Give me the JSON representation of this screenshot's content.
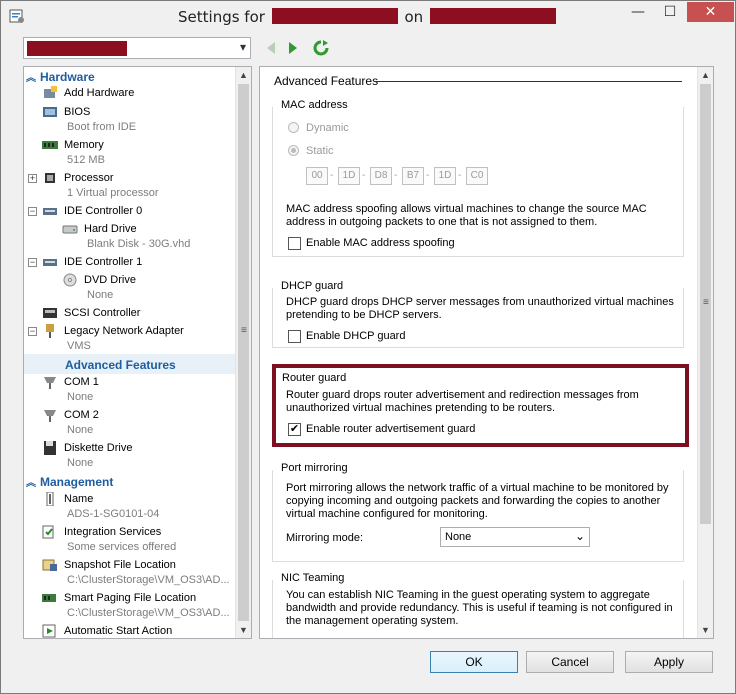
{
  "window": {
    "title_prefix": "Settings for",
    "title_middle": "on",
    "buttons": {
      "minimize": "—",
      "maximize": "☐",
      "close": "✕"
    }
  },
  "toolbar": {
    "vm_select_value": ""
  },
  "tree": {
    "hardware_header": "Hardware",
    "management_header": "Management",
    "hardware": [
      {
        "label": "Add Hardware",
        "sub": "",
        "icon": "add-hardware-icon"
      },
      {
        "label": "BIOS",
        "sub": "Boot from IDE",
        "icon": "bios-icon"
      },
      {
        "label": "Memory",
        "sub": "512 MB",
        "icon": "memory-icon"
      },
      {
        "label": "Processor",
        "sub": "1 Virtual processor",
        "icon": "processor-icon"
      },
      {
        "label": "IDE Controller 0",
        "sub": "",
        "icon": "ide-controller-icon"
      },
      {
        "label": "Hard Drive",
        "sub": "Blank Disk - 30G.vhd",
        "icon": "hard-drive-icon"
      },
      {
        "label": "IDE Controller 1",
        "sub": "",
        "icon": "ide-controller-icon"
      },
      {
        "label": "DVD Drive",
        "sub": "None",
        "icon": "dvd-drive-icon"
      },
      {
        "label": "SCSI Controller",
        "sub": "",
        "icon": "scsi-controller-icon"
      },
      {
        "label": "Legacy Network Adapter",
        "sub": "VMS",
        "icon": "network-adapter-icon"
      },
      {
        "label": "Advanced Features",
        "sub": "",
        "icon": ""
      },
      {
        "label": "COM 1",
        "sub": "None",
        "icon": "com-port-icon"
      },
      {
        "label": "COM 2",
        "sub": "None",
        "icon": "com-port-icon"
      },
      {
        "label": "Diskette Drive",
        "sub": "None",
        "icon": "diskette-icon"
      }
    ],
    "management": [
      {
        "label": "Name",
        "sub": "ADS-1-SG0101-04",
        "icon": "name-icon"
      },
      {
        "label": "Integration Services",
        "sub": "Some services offered",
        "icon": "integration-services-icon"
      },
      {
        "label": "Snapshot File Location",
        "sub": "C:\\ClusterStorage\\VM_OS3\\AD...",
        "icon": "snapshot-icon"
      },
      {
        "label": "Smart Paging File Location",
        "sub": "C:\\ClusterStorage\\VM_OS3\\AD...",
        "icon": "smart-paging-icon"
      },
      {
        "label": "Automatic Start Action",
        "sub": "",
        "icon": "auto-start-icon"
      }
    ]
  },
  "panel": {
    "title": "Advanced Features",
    "mac": {
      "group_title": "MAC address",
      "dynamic_label": "Dynamic",
      "static_label": "Static",
      "octets": [
        "00",
        "1D",
        "D8",
        "B7",
        "1D",
        "C0"
      ],
      "description": "MAC address spoofing allows virtual machines to change the source MAC address in outgoing packets to one that is not assigned to them.",
      "spoof_label": "Enable MAC address spoofing"
    },
    "dhcp": {
      "group_title": "DHCP guard",
      "description": "DHCP guard drops DHCP server messages from unauthorized virtual machines pretending to be DHCP servers.",
      "checkbox_label": "Enable DHCP guard"
    },
    "router": {
      "group_title": "Router guard",
      "description": "Router guard drops router advertisement and redirection messages from unauthorized virtual machines pretending to be routers.",
      "checkbox_label": "Enable router advertisement guard",
      "checked": true
    },
    "mirroring": {
      "group_title": "Port mirroring",
      "description": "Port mirroring allows the network traffic of a virtual machine to be monitored by copying incoming and outgoing packets and forwarding the copies to another virtual machine configured for monitoring.",
      "mode_label": "Mirroring mode:",
      "mode_value": "None"
    },
    "teaming": {
      "group_title": "NIC Teaming",
      "description": "You can establish NIC Teaming in the guest operating system to aggregate bandwidth and provide redundancy. This is useful if teaming is not configured in the management operating system."
    }
  },
  "buttons": {
    "ok": "OK",
    "cancel": "Cancel",
    "apply": "Apply"
  },
  "colors": {
    "accent": "#1e5da0",
    "highlight": "#7a1020",
    "redaction": "#8b0f20"
  }
}
